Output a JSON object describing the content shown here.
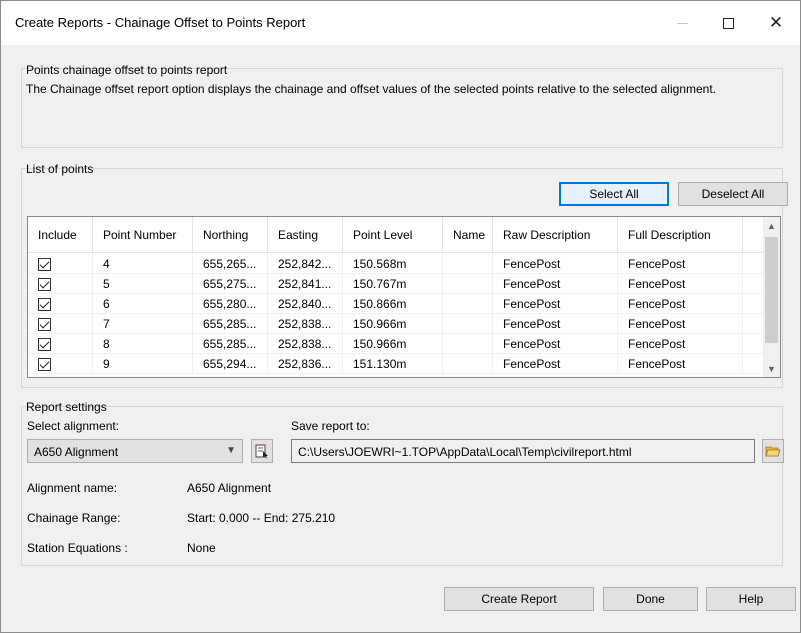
{
  "window": {
    "title": "Create Reports - Chainage Offset to Points Report"
  },
  "description": {
    "group_title": "Points chainage offset to points report",
    "text": "The Chainage offset report option displays the chainage and offset values of the selected points relative to the selected alignment."
  },
  "points": {
    "group_title": "List of points",
    "select_all_label": "Select All",
    "deselect_all_label": "Deselect All",
    "columns": [
      "Include",
      "Point Number",
      "Northing",
      "Easting",
      "Point Level",
      "Name",
      "Raw Description",
      "Full Description"
    ],
    "rows": [
      {
        "include": true,
        "point_number": "4",
        "northing": "655,265...",
        "easting": "252,842...",
        "level": "150.568m",
        "name": "",
        "raw": "FencePost",
        "full": "FencePost"
      },
      {
        "include": true,
        "point_number": "5",
        "northing": "655,275...",
        "easting": "252,841...",
        "level": "150.767m",
        "name": "",
        "raw": "FencePost",
        "full": "FencePost"
      },
      {
        "include": true,
        "point_number": "6",
        "northing": "655,280...",
        "easting": "252,840...",
        "level": "150.866m",
        "name": "",
        "raw": "FencePost",
        "full": "FencePost"
      },
      {
        "include": true,
        "point_number": "7",
        "northing": "655,285...",
        "easting": "252,838...",
        "level": "150.966m",
        "name": "",
        "raw": "FencePost",
        "full": "FencePost"
      },
      {
        "include": true,
        "point_number": "8",
        "northing": "655,285...",
        "easting": "252,838...",
        "level": "150.966m",
        "name": "",
        "raw": "FencePost",
        "full": "FencePost"
      },
      {
        "include": true,
        "point_number": "9",
        "northing": "655,294...",
        "easting": "252,836...",
        "level": "151.130m",
        "name": "",
        "raw": "FencePost",
        "full": "FencePost"
      }
    ]
  },
  "settings": {
    "group_title": "Report settings",
    "select_alignment_label": "Select alignment:",
    "alignment_value": "A650 Alignment",
    "save_report_label": "Save report to:",
    "save_path": "C:\\Users\\JOEWRI~1.TOP\\AppData\\Local\\Temp\\civilreport.html",
    "alignment_name_label": "Alignment name:",
    "alignment_name_value": "A650 Alignment",
    "chainage_range_label": "Chainage Range:",
    "chainage_range_value": "Start: 0.000 -- End: 275.210",
    "station_equations_label": "Station Equations :",
    "station_equations_value": "None"
  },
  "footer": {
    "create_report_label": "Create Report",
    "done_label": "Done",
    "help_label": "Help"
  },
  "colors": {
    "accent": "#0078d7",
    "window_bg": "#f0f0f0"
  }
}
